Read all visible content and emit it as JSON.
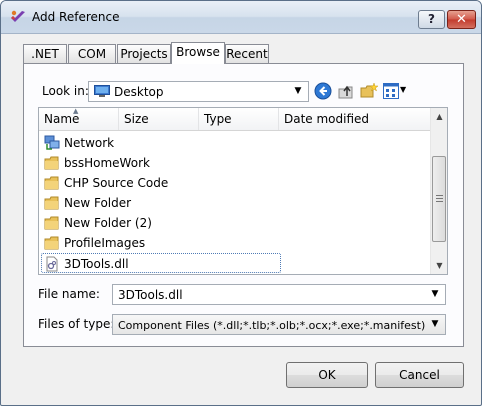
{
  "window": {
    "title": "Add Reference",
    "help_button": "?",
    "close_button": "✕"
  },
  "tabs": [
    {
      "label": ".NET"
    },
    {
      "label": "COM"
    },
    {
      "label": "Projects"
    },
    {
      "label": "Browse",
      "active": true
    },
    {
      "label": "Recent"
    }
  ],
  "browse": {
    "look_in_label": "Look in:",
    "look_in_value": "Desktop",
    "toolbar_icons": [
      "back-icon",
      "up-folder-icon",
      "new-folder-icon",
      "view-menu-icon"
    ],
    "columns": [
      "Name",
      "Size",
      "Type",
      "Date modified"
    ],
    "sort_column": "Name",
    "items": [
      {
        "name": "Network",
        "icon": "network-icon"
      },
      {
        "name": "bssHomeWork",
        "icon": "folder-icon"
      },
      {
        "name": "CHP Source Code",
        "icon": "folder-icon"
      },
      {
        "name": "New Folder",
        "icon": "folder-icon"
      },
      {
        "name": "New Folder (2)",
        "icon": "folder-icon"
      },
      {
        "name": "ProfileImages",
        "icon": "folder-icon"
      },
      {
        "name": "3DTools.dll",
        "icon": "dll-file-icon",
        "selected": true
      }
    ],
    "file_name_label": "File name:",
    "file_name_value": "3DTools.dll",
    "file_type_label": "Files of type:",
    "file_type_value": "Component Files (*.dll;*.tlb;*.olb;*.ocx;*.exe;*.manifest)"
  },
  "buttons": {
    "ok": "OK",
    "cancel": "Cancel"
  },
  "colors": {
    "title_gradient_top": "#e9eff7",
    "title_gradient_bottom": "#cad8e8",
    "close_button": "#c23a2c",
    "selection_border": "#4f7bb5",
    "folder": "#e8c15a"
  }
}
